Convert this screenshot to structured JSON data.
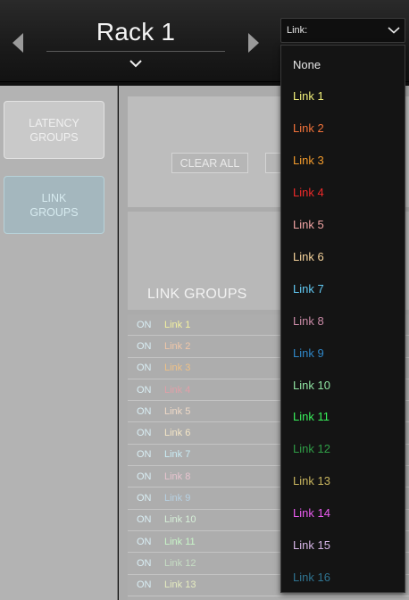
{
  "header": {
    "title": "Rack 1",
    "prev_icon": "triangle-left-icon",
    "next_icon": "triangle-right-icon",
    "expand_icon": "chevron-down-icon"
  },
  "link_select": {
    "label": "Link:",
    "arrow_icon": "chevron-down-icon"
  },
  "sidebar": {
    "latency_groups": "LATENCY\nGROUPS",
    "link_groups": "LINK\nGROUPS"
  },
  "toolbar": {
    "clear_all": "CLEAR ALL",
    "secondary": "·"
  },
  "groups_panel": {
    "heading": "LINK GROUPS",
    "rows": [
      {
        "on": "ON",
        "name": "Link 1",
        "color": "#f3f1a0"
      },
      {
        "on": "ON",
        "name": "Link 2",
        "color": "#f0c6a8"
      },
      {
        "on": "ON",
        "name": "Link 3",
        "color": "#efc186"
      },
      {
        "on": "ON",
        "name": "Link 4",
        "color": "#e0a0a8"
      },
      {
        "on": "ON",
        "name": "Link 5",
        "color": "#efd9c6"
      },
      {
        "on": "ON",
        "name": "Link 6",
        "color": "#f5e6c6"
      },
      {
        "on": "ON",
        "name": "Link 7",
        "color": "#c9ecf5"
      },
      {
        "on": "ON",
        "name": "Link 8",
        "color": "#e7c4cf"
      },
      {
        "on": "ON",
        "name": "Link 9",
        "color": "#b6d1e3"
      },
      {
        "on": "ON",
        "name": "Link 10",
        "color": "#d6f0d8"
      },
      {
        "on": "ON",
        "name": "Link 11",
        "color": "#c8f5c8"
      },
      {
        "on": "ON",
        "name": "Link 12",
        "color": "#c6ddc4"
      },
      {
        "on": "ON",
        "name": "Link 13",
        "color": "#e5ecc0"
      }
    ]
  },
  "dropdown": {
    "items": [
      {
        "label": "None",
        "color": "#e8e8e8"
      },
      {
        "label": "Link 1",
        "color": "#f1f07a"
      },
      {
        "label": "Link 2",
        "color": "#f2723a"
      },
      {
        "label": "Link 3",
        "color": "#f19a2c"
      },
      {
        "label": "Link 4",
        "color": "#ee2a2a"
      },
      {
        "label": "Link 5",
        "color": "#f1a3a3"
      },
      {
        "label": "Link 6",
        "color": "#f6d39b"
      },
      {
        "label": "Link 7",
        "color": "#61c8f2"
      },
      {
        "label": "Link 8",
        "color": "#c98aa6"
      },
      {
        "label": "Link 9",
        "color": "#2f86c7"
      },
      {
        "label": "Link 10",
        "color": "#8fe3a1"
      },
      {
        "label": "Link 11",
        "color": "#38f05a"
      },
      {
        "label": "Link 12",
        "color": "#2f9c46"
      },
      {
        "label": "Link 13",
        "color": "#c7b45e"
      },
      {
        "label": "Link 14",
        "color": "#ea5cf0"
      },
      {
        "label": "Link 15",
        "color": "#d6b5e6"
      },
      {
        "label": "Link 16",
        "color": "#2f7390"
      }
    ]
  }
}
